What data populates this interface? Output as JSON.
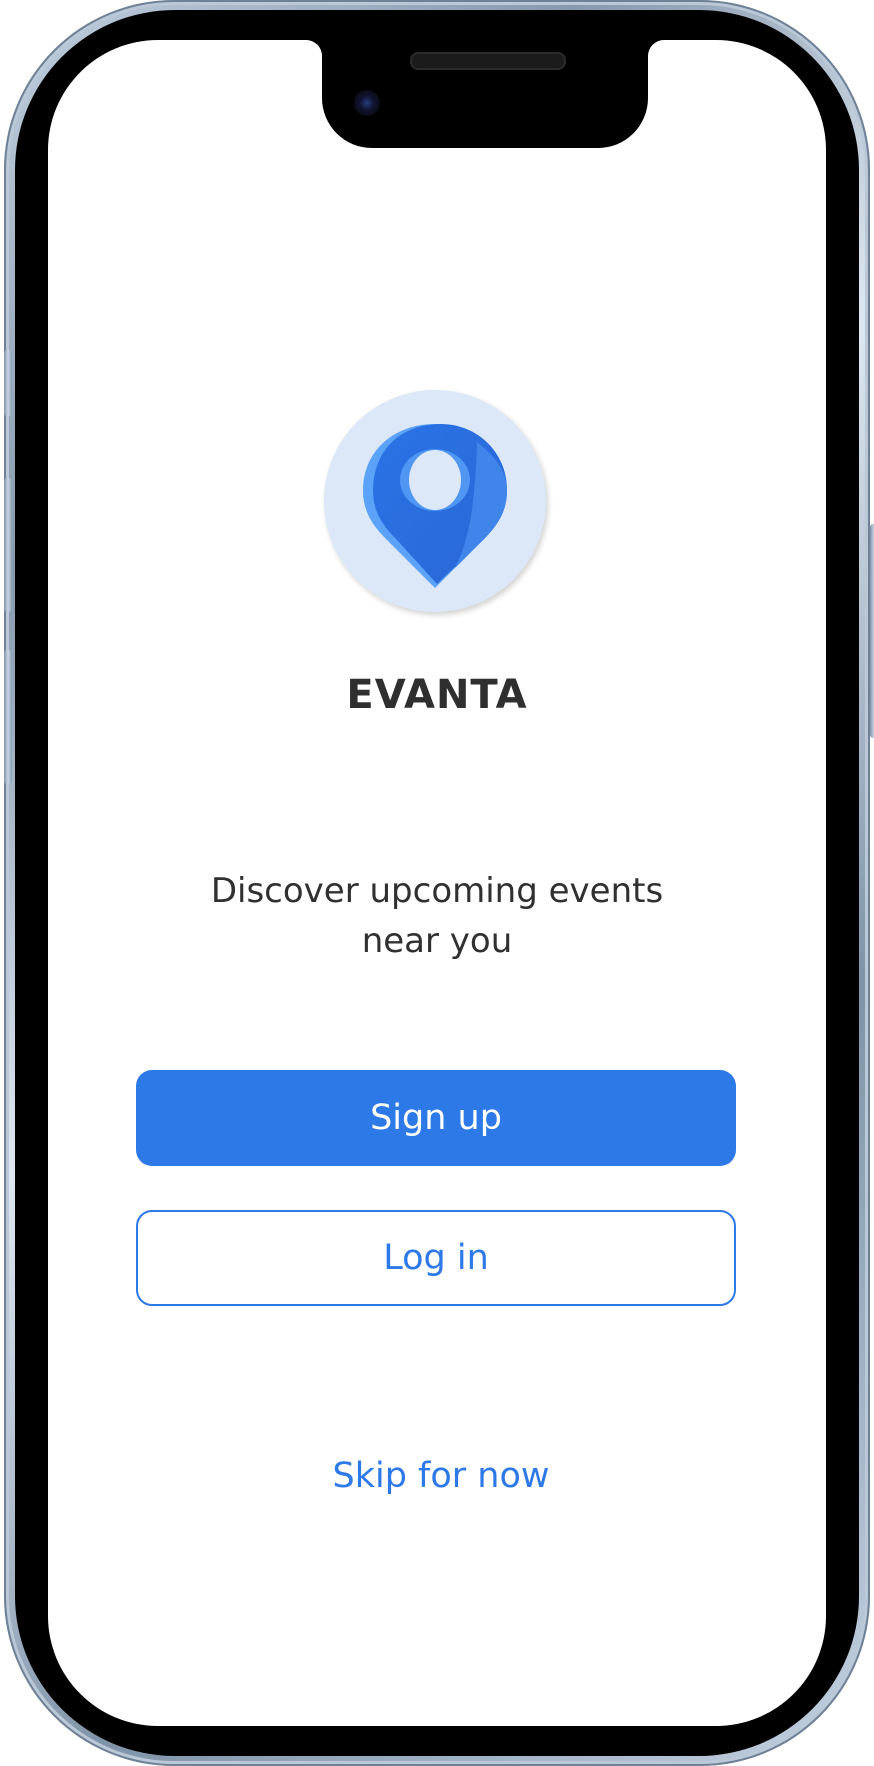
{
  "app": {
    "name": "EVANTA",
    "tagline": "Discover upcoming events near you"
  },
  "actions": {
    "signup_label": "Sign up",
    "login_label": "Log in",
    "skip_label": "Skip for now"
  },
  "icons": {
    "logo": "location-pin-icon"
  },
  "colors": {
    "accent": "#2C79E7",
    "logo_background": "#DCE7F7",
    "text_primary": "#303030",
    "background": "#FFFFFF"
  }
}
